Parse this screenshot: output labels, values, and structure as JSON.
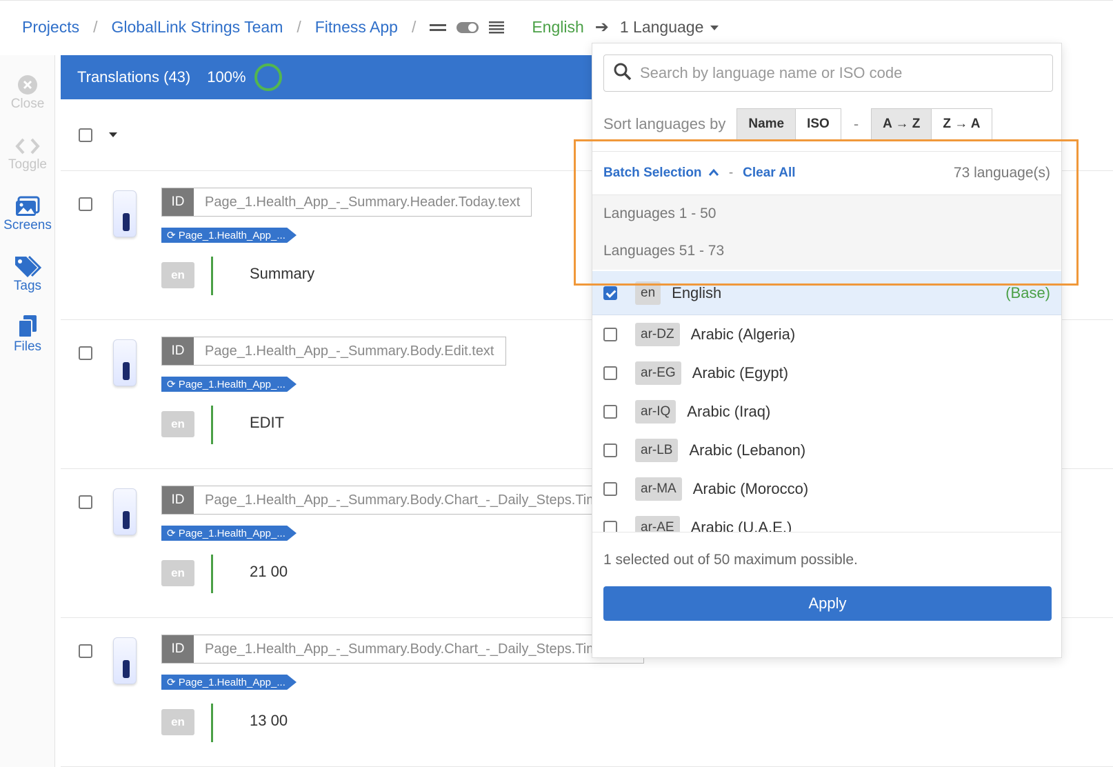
{
  "breadcrumb": {
    "items": [
      "Projects",
      "GlobalLink Strings Team",
      "Fitness App"
    ],
    "separator": "/",
    "source_language": "English",
    "target_selector": "1 Language"
  },
  "rail": {
    "close": "Close",
    "toggle": "Toggle",
    "screens": "Screens",
    "tags": "Tags",
    "files": "Files"
  },
  "translations": {
    "title": "Translations (43)",
    "progress": "100%",
    "entries": [
      {
        "id_label": "ID",
        "id": "Page_1.Health_App_-_Summary.Header.Today.text",
        "screen": "Page_1.Health_App_...",
        "lang": "en",
        "text": "Summary"
      },
      {
        "id_label": "ID",
        "id": "Page_1.Health_App_-_Summary.Body.Edit.text",
        "screen": "Page_1.Health_App_...",
        "lang": "en",
        "text": "EDIT"
      },
      {
        "id_label": "ID",
        "id": "Page_1.Health_App_-_Summary.Body.Chart_-_Daily_Steps.Tim",
        "screen": "Page_1.Health_App_...",
        "lang": "en",
        "text": "21 00"
      },
      {
        "id_label": "ID",
        "id": "Page_1.Health_App_-_Summary.Body.Chart_-_Daily_Steps.Tim",
        "screen": "Page_1.Health_App_...",
        "lang": "en",
        "text": "13 00"
      }
    ]
  },
  "dropdown": {
    "search_placeholder": "Search by language name or ISO code",
    "sort_label": "Sort languages by",
    "sort_name": "Name",
    "sort_iso": "ISO",
    "sort_dash": "-",
    "sort_az": "A → Z",
    "sort_za": "Z → A",
    "batch_selection": "Batch Selection",
    "batch_dash": "-",
    "clear_all": "Clear All",
    "language_count": "73 language(s)",
    "batch_options": [
      "Languages 1 - 50",
      "Languages 51 - 73"
    ],
    "languages": [
      {
        "code": "en",
        "name": "English",
        "checked": true,
        "note": "(Base)"
      },
      {
        "code": "ar-DZ",
        "name": "Arabic (Algeria)",
        "checked": false
      },
      {
        "code": "ar-EG",
        "name": "Arabic (Egypt)",
        "checked": false
      },
      {
        "code": "ar-IQ",
        "name": "Arabic (Iraq)",
        "checked": false
      },
      {
        "code": "ar-LB",
        "name": "Arabic (Lebanon)",
        "checked": false
      },
      {
        "code": "ar-MA",
        "name": "Arabic (Morocco)",
        "checked": false
      },
      {
        "code": "ar-AE",
        "name": "Arabic (U.A.E.)",
        "checked": false
      }
    ],
    "selection_note": "1 selected out of 50 maximum possible.",
    "apply": "Apply"
  },
  "colors": {
    "accent": "#3574cc",
    "success": "#4aa046",
    "highlight": "#f0983a"
  }
}
